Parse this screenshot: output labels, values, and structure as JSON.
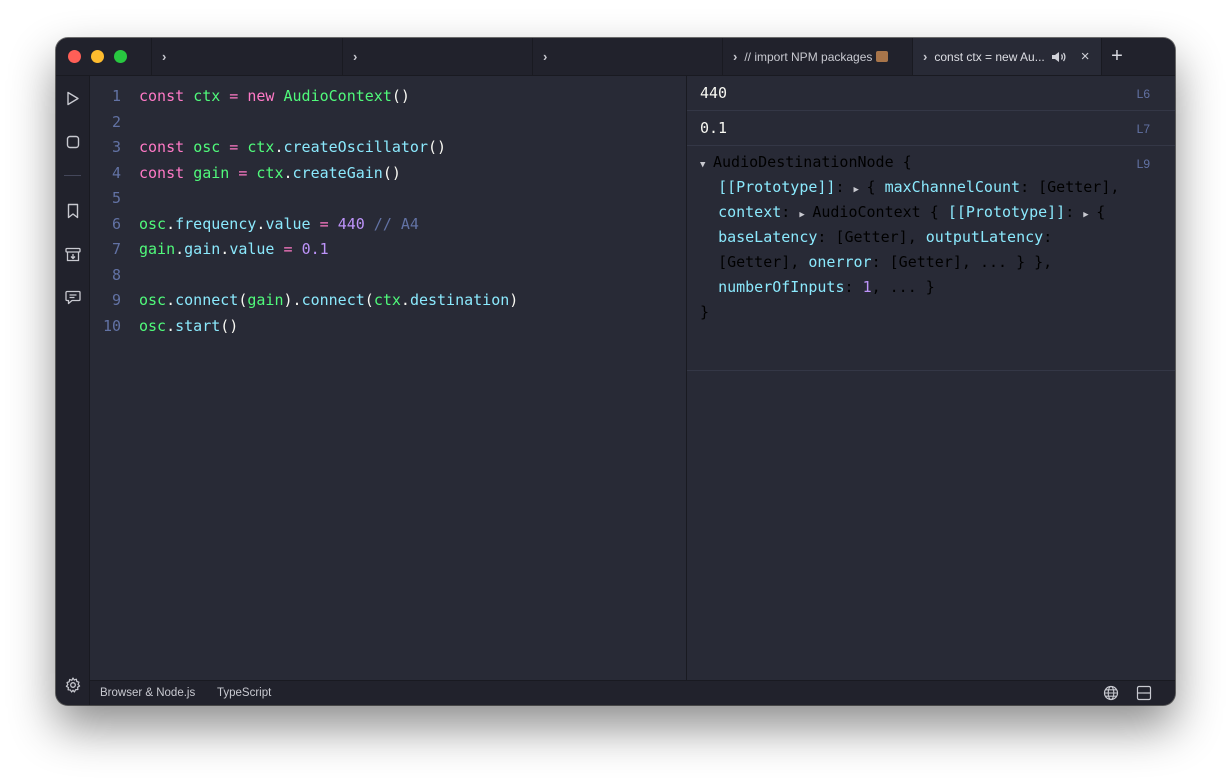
{
  "colors": {
    "keyword": "#ff79c6",
    "function": "#50fa7b",
    "property": "#8be9fd",
    "number": "#bd93f9",
    "comment": "#6272a4",
    "text": "#f8f8f2",
    "background": "#282a36"
  },
  "tabs": [
    {
      "chevron": "›",
      "label": ""
    },
    {
      "chevron": "›",
      "label": ""
    },
    {
      "chevron": "›",
      "label": ""
    },
    {
      "chevron": "›",
      "label": "// import NPM packages",
      "icon": "package-icon"
    },
    {
      "chevron": "›",
      "label": "const ctx = new Au...",
      "icon": "speaker-icon",
      "close": "×",
      "active": true
    }
  ],
  "new_tab_label": "+",
  "sidebar": [
    "run-icon",
    "stop-icon",
    "bookmark-icon",
    "archive-icon",
    "chat-icon",
    "settings-icon"
  ],
  "editor": {
    "lines": [
      {
        "n": "1",
        "tokens": [
          [
            "kw",
            "const "
          ],
          [
            "fn",
            "ctx"
          ],
          [
            "kw",
            " = "
          ],
          [
            "kw",
            "new "
          ],
          [
            "fn",
            "AudioContext"
          ],
          [
            "tx",
            "()"
          ]
        ]
      },
      {
        "n": "2",
        "tokens": []
      },
      {
        "n": "3",
        "tokens": [
          [
            "kw",
            "const "
          ],
          [
            "fn",
            "osc"
          ],
          [
            "kw",
            " = "
          ],
          [
            "fn",
            "ctx"
          ],
          [
            "tx",
            "."
          ],
          [
            "pr",
            "createOscillator"
          ],
          [
            "tx",
            "()"
          ]
        ]
      },
      {
        "n": "4",
        "tokens": [
          [
            "kw",
            "const "
          ],
          [
            "fn",
            "gain"
          ],
          [
            "kw",
            " = "
          ],
          [
            "fn",
            "ctx"
          ],
          [
            "tx",
            "."
          ],
          [
            "pr",
            "createGain"
          ],
          [
            "tx",
            "()"
          ]
        ]
      },
      {
        "n": "5",
        "tokens": []
      },
      {
        "n": "6",
        "tokens": [
          [
            "fn",
            "osc"
          ],
          [
            "tx",
            "."
          ],
          [
            "pr",
            "frequency"
          ],
          [
            "tx",
            "."
          ],
          [
            "pr",
            "value"
          ],
          [
            "kw",
            " = "
          ],
          [
            "nu",
            "440"
          ],
          [
            "cm",
            " // A4"
          ]
        ]
      },
      {
        "n": "7",
        "tokens": [
          [
            "fn",
            "gain"
          ],
          [
            "tx",
            "."
          ],
          [
            "pr",
            "gain"
          ],
          [
            "tx",
            "."
          ],
          [
            "pr",
            "value"
          ],
          [
            "kw",
            " = "
          ],
          [
            "nu",
            "0.1"
          ]
        ]
      },
      {
        "n": "8",
        "tokens": []
      },
      {
        "n": "9",
        "tokens": [
          [
            "fn",
            "osc"
          ],
          [
            "tx",
            "."
          ],
          [
            "pr",
            "connect"
          ],
          [
            "tx",
            "("
          ],
          [
            "fn",
            "gain"
          ],
          [
            "tx",
            ")."
          ],
          [
            "pr",
            "connect"
          ],
          [
            "tx",
            "("
          ],
          [
            "fn",
            "ctx"
          ],
          [
            "tx",
            "."
          ],
          [
            "pr",
            "destination"
          ],
          [
            "tx",
            ")"
          ]
        ]
      },
      {
        "n": "10",
        "tokens": [
          [
            "fn",
            "osc"
          ],
          [
            "tx",
            "."
          ],
          [
            "pr",
            "start"
          ],
          [
            "tx",
            "()"
          ]
        ]
      }
    ]
  },
  "output": {
    "results": [
      {
        "value": "440",
        "line": "L6"
      },
      {
        "value": "0.1",
        "line": "L7"
      }
    ],
    "object": {
      "line": "L9",
      "lines": [
        [
          [
            "tri",
            "▼"
          ],
          [
            "tx",
            "AudioDestinationNode {"
          ]
        ],
        [
          [
            "sp",
            "  "
          ],
          [
            "pr",
            "[[Prototype]]"
          ],
          [
            "tx",
            ": "
          ],
          [
            "tri",
            "▶"
          ],
          [
            "tx",
            "{ "
          ],
          [
            "pr",
            "maxChannelCount"
          ],
          [
            "tx",
            ": [Getter],"
          ]
        ],
        [
          [
            "sp",
            "  "
          ],
          [
            "pr",
            "context"
          ],
          [
            "tx",
            ": "
          ],
          [
            "tri",
            "▶"
          ],
          [
            "tx",
            "AudioContext { "
          ],
          [
            "pr",
            "[[Prototype]]"
          ],
          [
            "tx",
            ": "
          ],
          [
            "tri",
            "▶"
          ],
          [
            "tx",
            "{"
          ]
        ],
        [
          [
            "sp",
            "  "
          ],
          [
            "pr",
            "baseLatency"
          ],
          [
            "tx",
            ": [Getter], "
          ],
          [
            "pr",
            "outputLatency"
          ],
          [
            "tx",
            ":"
          ]
        ],
        [
          [
            "sp",
            "  "
          ],
          [
            "tx",
            "[Getter], "
          ],
          [
            "pr",
            "onerror"
          ],
          [
            "tx",
            ": [Getter], ... } },"
          ]
        ],
        [
          [
            "sp",
            "  "
          ],
          [
            "pr",
            "numberOfInputs"
          ],
          [
            "tx",
            ": "
          ],
          [
            "nu",
            "1"
          ],
          [
            "tx",
            ", ... }"
          ]
        ],
        [
          [
            "tx",
            "}"
          ]
        ]
      ]
    }
  },
  "statusbar": {
    "environment": "Browser & Node.js",
    "language": "TypeScript",
    "right_icons": [
      "globe-icon",
      "split-layout-icon"
    ]
  }
}
